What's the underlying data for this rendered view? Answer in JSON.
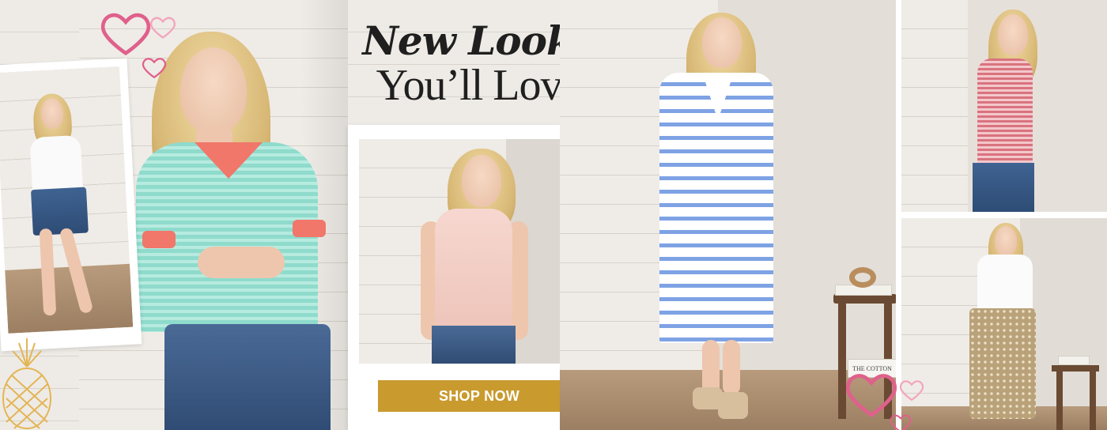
{
  "hero": {
    "headline_line1": "New Looks",
    "headline_line2": "You’ll Love",
    "cta_label": "SHOP NOW"
  },
  "decorations": {
    "heart_icon": "heart-icon",
    "pineapple_icon": "pineapple-icon",
    "accent_pink": "#e0608c",
    "accent_gold": "#c99a2e"
  },
  "photos": {
    "book_spine_text": "THE COTTON"
  }
}
